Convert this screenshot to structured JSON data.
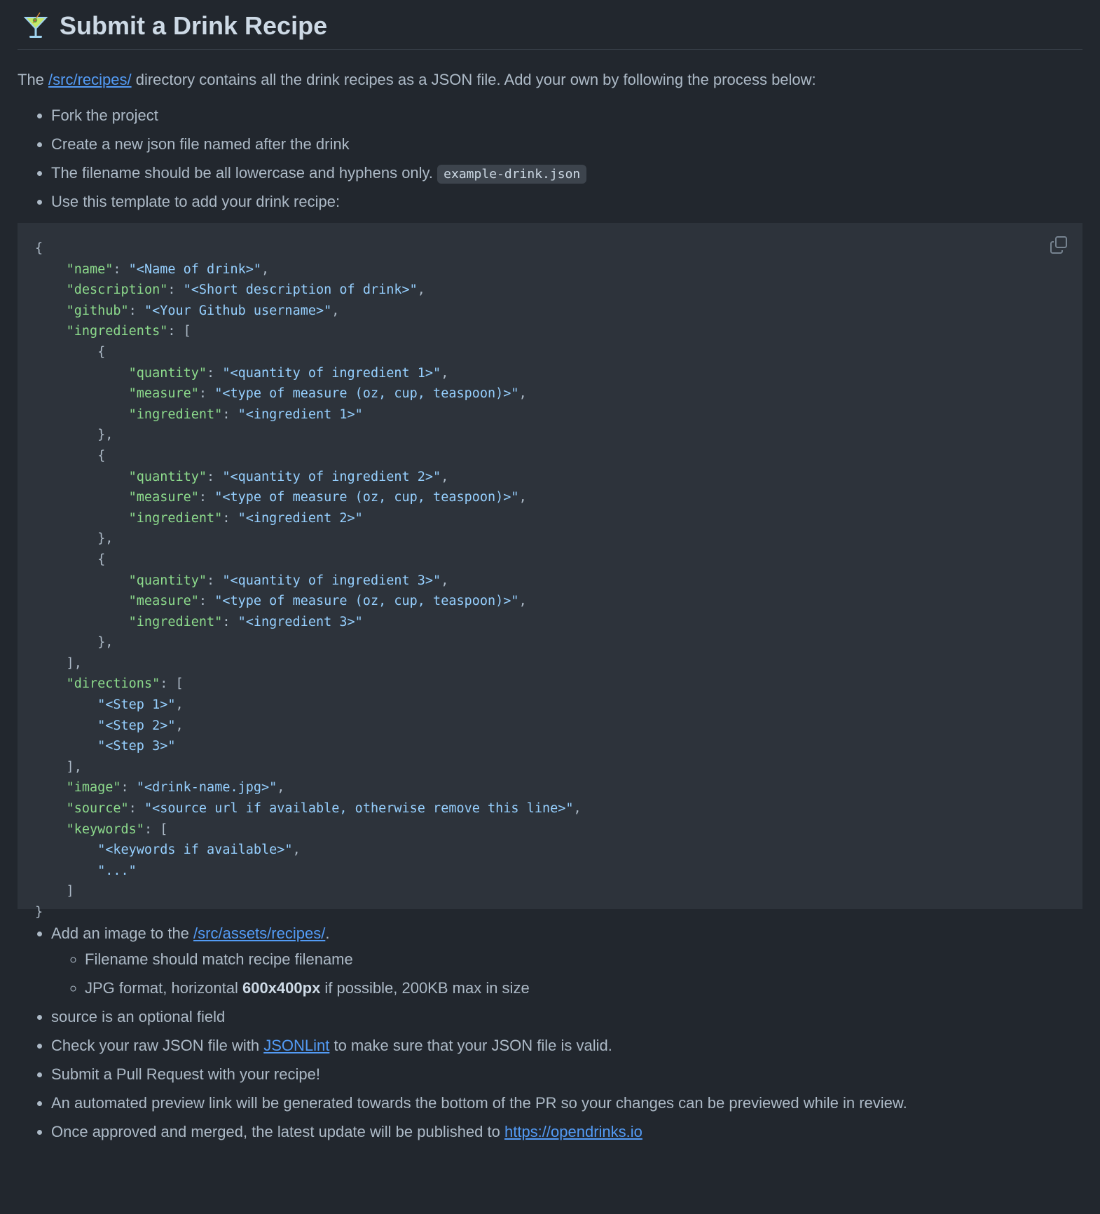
{
  "heading": {
    "icon": "cocktail-glass-icon",
    "title": "Submit a Drink Recipe"
  },
  "intro": {
    "before": "The ",
    "link": "/src/recipes/",
    "after": " directory contains all the drink recipes as a JSON file. Add your own by following the process below:"
  },
  "steps_top": [
    "Fork the project",
    "Create a new json file named after the drink",
    "The filename should be all lowercase and hyphens only.",
    "Use this template to add your drink recipe:"
  ],
  "filename_example": "example-drink.json",
  "code_block": {
    "copy_icon": "copy-icon",
    "lines": [
      [
        [
          "p",
          "{"
        ]
      ],
      [
        [
          "p",
          "    "
        ],
        [
          "k",
          "\"name\""
        ],
        [
          "p",
          ": "
        ],
        [
          "s",
          "\"<Name of drink>\""
        ],
        [
          "p",
          ","
        ]
      ],
      [
        [
          "p",
          "    "
        ],
        [
          "k",
          "\"description\""
        ],
        [
          "p",
          ": "
        ],
        [
          "s",
          "\"<Short description of drink>\""
        ],
        [
          "p",
          ","
        ]
      ],
      [
        [
          "p",
          "    "
        ],
        [
          "k",
          "\"github\""
        ],
        [
          "p",
          ": "
        ],
        [
          "s",
          "\"<Your Github username>\""
        ],
        [
          "p",
          ","
        ]
      ],
      [
        [
          "p",
          "    "
        ],
        [
          "k",
          "\"ingredients\""
        ],
        [
          "p",
          ": ["
        ]
      ],
      [
        [
          "p",
          "        {"
        ]
      ],
      [
        [
          "p",
          "            "
        ],
        [
          "k",
          "\"quantity\""
        ],
        [
          "p",
          ": "
        ],
        [
          "s",
          "\"<quantity of ingredient 1>\""
        ],
        [
          "p",
          ","
        ]
      ],
      [
        [
          "p",
          "            "
        ],
        [
          "k",
          "\"measure\""
        ],
        [
          "p",
          ": "
        ],
        [
          "s",
          "\"<type of measure (oz, cup, teaspoon)>\""
        ],
        [
          "p",
          ","
        ]
      ],
      [
        [
          "p",
          "            "
        ],
        [
          "k",
          "\"ingredient\""
        ],
        [
          "p",
          ": "
        ],
        [
          "s",
          "\"<ingredient 1>\""
        ]
      ],
      [
        [
          "p",
          "        },"
        ]
      ],
      [
        [
          "p",
          "        {"
        ]
      ],
      [
        [
          "p",
          "            "
        ],
        [
          "k",
          "\"quantity\""
        ],
        [
          "p",
          ": "
        ],
        [
          "s",
          "\"<quantity of ingredient 2>\""
        ],
        [
          "p",
          ","
        ]
      ],
      [
        [
          "p",
          "            "
        ],
        [
          "k",
          "\"measure\""
        ],
        [
          "p",
          ": "
        ],
        [
          "s",
          "\"<type of measure (oz, cup, teaspoon)>\""
        ],
        [
          "p",
          ","
        ]
      ],
      [
        [
          "p",
          "            "
        ],
        [
          "k",
          "\"ingredient\""
        ],
        [
          "p",
          ": "
        ],
        [
          "s",
          "\"<ingredient 2>\""
        ]
      ],
      [
        [
          "p",
          "        },"
        ]
      ],
      [
        [
          "p",
          "        {"
        ]
      ],
      [
        [
          "p",
          "            "
        ],
        [
          "k",
          "\"quantity\""
        ],
        [
          "p",
          ": "
        ],
        [
          "s",
          "\"<quantity of ingredient 3>\""
        ],
        [
          "p",
          ","
        ]
      ],
      [
        [
          "p",
          "            "
        ],
        [
          "k",
          "\"measure\""
        ],
        [
          "p",
          ": "
        ],
        [
          "s",
          "\"<type of measure (oz, cup, teaspoon)>\""
        ],
        [
          "p",
          ","
        ]
      ],
      [
        [
          "p",
          "            "
        ],
        [
          "k",
          "\"ingredient\""
        ],
        [
          "p",
          ": "
        ],
        [
          "s",
          "\"<ingredient 3>\""
        ]
      ],
      [
        [
          "p",
          "        },"
        ]
      ],
      [
        [
          "p",
          "    ],"
        ]
      ],
      [
        [
          "p",
          "    "
        ],
        [
          "k",
          "\"directions\""
        ],
        [
          "p",
          ": ["
        ]
      ],
      [
        [
          "p",
          "        "
        ],
        [
          "s",
          "\"<Step 1>\""
        ],
        [
          "p",
          ","
        ]
      ],
      [
        [
          "p",
          "        "
        ],
        [
          "s",
          "\"<Step 2>\""
        ],
        [
          "p",
          ","
        ]
      ],
      [
        [
          "p",
          "        "
        ],
        [
          "s",
          "\"<Step 3>\""
        ]
      ],
      [
        [
          "p",
          "    ],"
        ]
      ],
      [
        [
          "p",
          "    "
        ],
        [
          "k",
          "\"image\""
        ],
        [
          "p",
          ": "
        ],
        [
          "s",
          "\"<drink-name.jpg>\""
        ],
        [
          "p",
          ","
        ]
      ],
      [
        [
          "p",
          "    "
        ],
        [
          "k",
          "\"source\""
        ],
        [
          "p",
          ": "
        ],
        [
          "s",
          "\"<source url if available, otherwise remove this line>\""
        ],
        [
          "p",
          ","
        ]
      ],
      [
        [
          "p",
          "    "
        ],
        [
          "k",
          "\"keywords\""
        ],
        [
          "p",
          ": ["
        ]
      ],
      [
        [
          "p",
          "        "
        ],
        [
          "s",
          "\"<keywords if available>\""
        ],
        [
          "p",
          ","
        ]
      ],
      [
        [
          "p",
          "        "
        ],
        [
          "s",
          "\"...\""
        ]
      ],
      [
        [
          "p",
          "    ]"
        ]
      ],
      [
        [
          "p",
          "}"
        ]
      ]
    ]
  },
  "steps_bottom": {
    "add_image": {
      "before": "Add an image to the ",
      "link": "/src/assets/recipes/",
      "after": "."
    },
    "add_image_sub": [
      {
        "text": "Filename should match recipe filename"
      },
      {
        "before": "JPG format, horizontal ",
        "bold": "600x400px",
        "after": " if possible, 200KB max in size"
      }
    ],
    "source_optional": "source is an optional field",
    "check_json": {
      "before": "Check your raw JSON file with ",
      "link": "JSONLint",
      "after": " to make sure that your JSON file is valid."
    },
    "submit_pr": "Submit a Pull Request with your recipe!",
    "preview": "An automated preview link will be generated towards the bottom of the PR so your changes can be previewed while in review.",
    "publish": {
      "before": "Once approved and merged, the latest update will be published to ",
      "link": "https://opendrinks.io"
    }
  },
  "colors": {
    "background": "#22272e",
    "code_background": "#2d333b",
    "text": "#adbac7",
    "link": "#539bf5",
    "json_key": "#8ddb8c",
    "json_string": "#96d0ff"
  }
}
